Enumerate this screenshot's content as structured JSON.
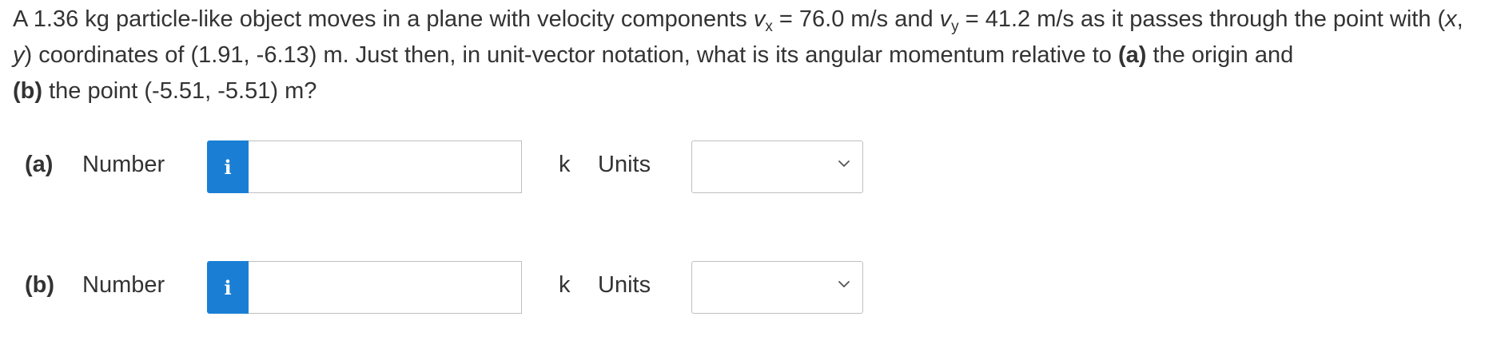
{
  "question": {
    "seg1": "A 1.36 kg particle-like object moves in a plane with velocity components ",
    "vx_symbol": "v",
    "vx_sub": "x",
    "seg2": " = 76.0 m/s and ",
    "vy_symbol": "v",
    "vy_sub": "y",
    "seg3": " = 41.2 m/s as it passes through the point with (",
    "x_symbol": "x",
    "seg4": ", ",
    "y_symbol": "y",
    "seg5": ") coordinates of (1.91, -6.13) m. Just then, in unit-vector notation, what is its angular momentum relative to ",
    "part_a": "(a)",
    "seg6": " the origin and ",
    "part_b": "(b)",
    "seg7": " the point (-5.51, -5.51) m?"
  },
  "answers": [
    {
      "part_label": "(a)",
      "number_label": "Number",
      "info_icon": "i",
      "value": "",
      "unit_vector": "k",
      "units_label": "Units",
      "units_selected": ""
    },
    {
      "part_label": "(b)",
      "number_label": "Number",
      "info_icon": "i",
      "value": "",
      "unit_vector": "k",
      "units_label": "Units",
      "units_selected": ""
    }
  ],
  "colors": {
    "info_button": "#1a7fd4",
    "text": "#333333",
    "border": "#bfbfbf"
  },
  "icons": {
    "info": "info-icon",
    "dropdown": "chevron-down-icon"
  }
}
